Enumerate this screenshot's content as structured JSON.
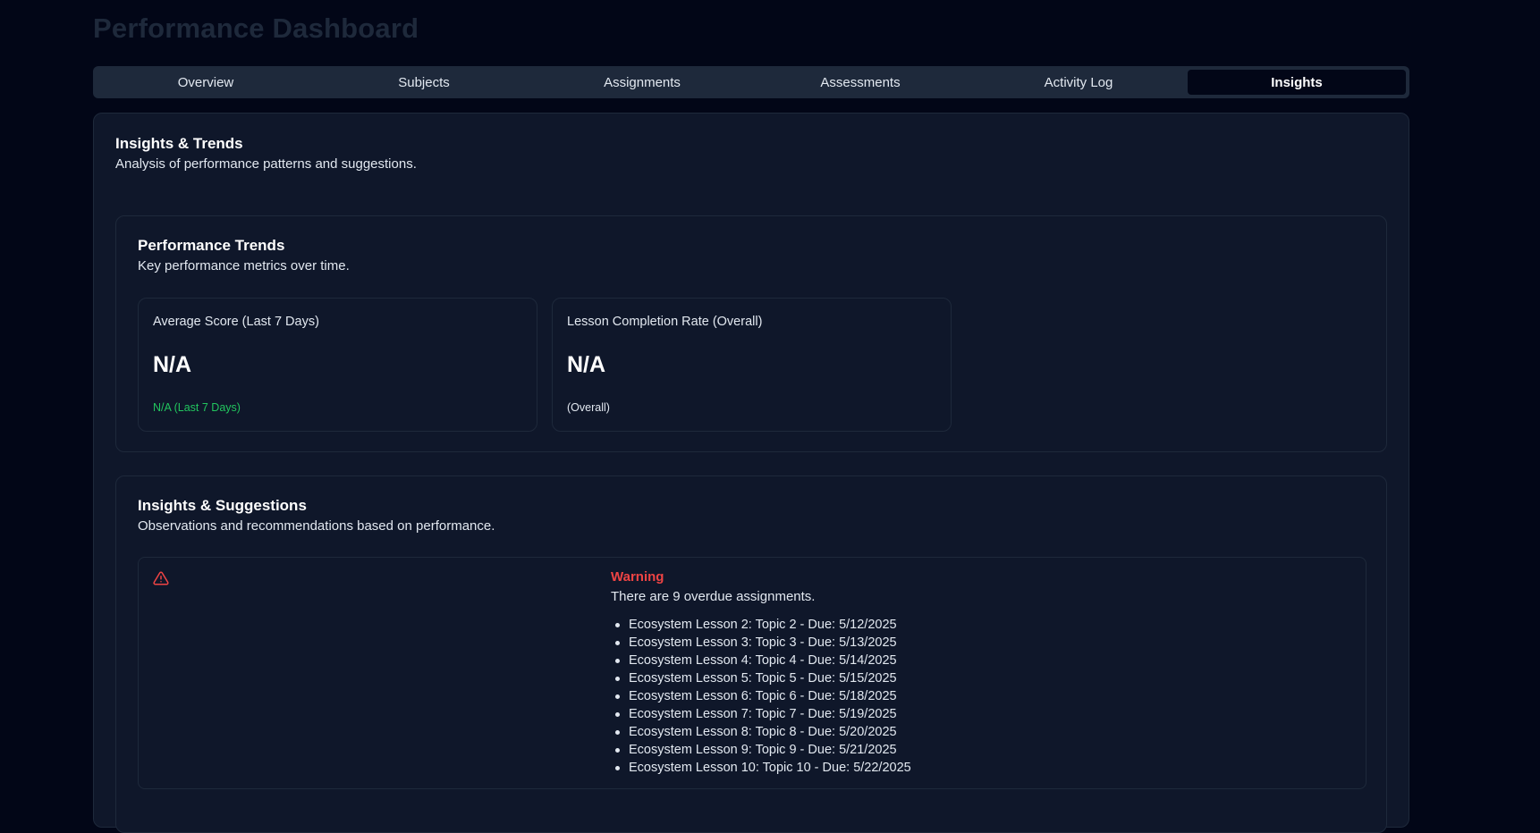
{
  "page": {
    "title": "Performance Dashboard"
  },
  "tabs": [
    {
      "label": "Overview",
      "active": false
    },
    {
      "label": "Subjects",
      "active": false
    },
    {
      "label": "Assignments",
      "active": false
    },
    {
      "label": "Assessments",
      "active": false
    },
    {
      "label": "Activity Log",
      "active": false
    },
    {
      "label": "Insights",
      "active": true
    }
  ],
  "insights": {
    "title": "Insights & Trends",
    "description": "Analysis of performance patterns and suggestions."
  },
  "trends": {
    "title": "Performance Trends",
    "description": "Key performance metrics over time.",
    "metrics": [
      {
        "label": "Average Score (Last 7 Days)",
        "value": "N/A",
        "sub": "N/A (Last 7 Days)",
        "sub_color": "#22c55e"
      },
      {
        "label": "Lesson Completion Rate (Overall)",
        "value": "N/A",
        "sub": "(Overall)",
        "sub_color": "#e2e8f0"
      }
    ]
  },
  "suggestions": {
    "title": "Insights & Suggestions",
    "description": "Observations and recommendations based on performance.",
    "alert": {
      "icon": "warning-triangle-icon",
      "title": "Warning",
      "message": "There are 9 overdue assignments.",
      "items": [
        "Ecosystem Lesson 2: Topic 2 - Due: 5/12/2025",
        "Ecosystem Lesson 3: Topic 3 - Due: 5/13/2025",
        "Ecosystem Lesson 4: Topic 4 - Due: 5/14/2025",
        "Ecosystem Lesson 5: Topic 5 - Due: 5/15/2025",
        "Ecosystem Lesson 6: Topic 6 - Due: 5/18/2025",
        "Ecosystem Lesson 7: Topic 7 - Due: 5/19/2025",
        "Ecosystem Lesson 8: Topic 8 - Due: 5/20/2025",
        "Ecosystem Lesson 9: Topic 9 - Due: 5/21/2025",
        "Ecosystem Lesson 10: Topic 10 - Due: 5/22/2025"
      ]
    }
  },
  "colors": {
    "background": "#020617",
    "card": "#0f172a",
    "border": "#1e293b",
    "warning": "#ef4444",
    "positive": "#22c55e"
  }
}
